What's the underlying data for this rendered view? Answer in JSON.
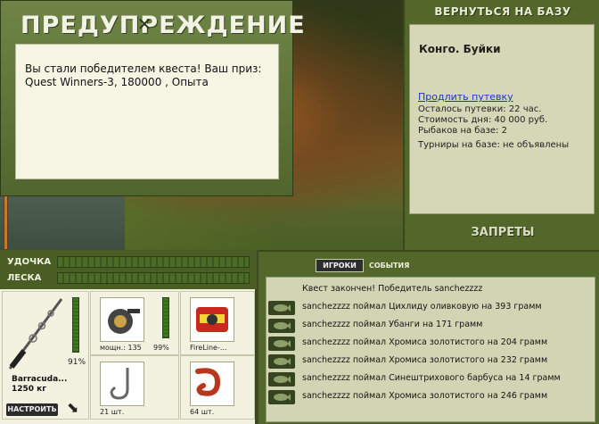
{
  "warning": {
    "title": "ПРЕДУПРЕЖДЕНИЕ",
    "message_line1": "Вы стали победителем квеста! Ваш приз:",
    "message_line2": "Quest Winners-3, 180000 , Опыта"
  },
  "base": {
    "return_label": "ВЕРНУТЬСЯ НА БАЗУ",
    "name": "Конго. Буйки",
    "extend_link": "Продлить путевку",
    "time_left": "Осталось путевки: 22 час.",
    "day_cost": "Стоимость дня: 40 000 руб.",
    "anglers": "Рыбаков на базе: 2",
    "tournaments": "Турниры на базе: не объявлены",
    "bans_label": "ЗАПРЕТЫ"
  },
  "gauges": {
    "rod_label": "УДОЧКА",
    "line_label": "ЛЕСКА"
  },
  "inventory": {
    "rod_name": "Barracuda...",
    "rod_weight": "1250 кг",
    "rod_condition": "91%",
    "setup_button": "НАСТРОИТЬ",
    "reel_power": "мощн.: 135",
    "reel_condition": "99%",
    "line_name": "FireLine-...",
    "hook_count": "21 шт.",
    "bait_count": "64 шт.",
    "icons": {
      "rod": "fishing-rod-icon",
      "reel": "reel-icon",
      "line": "line-spool-icon",
      "hook": "hook-icon",
      "bait": "worm-bait-icon",
      "arrow": "arrow-down-right-icon"
    }
  },
  "events": {
    "tab_players": "ИГРОКИ",
    "tab_events": "СОБЫТИЯ",
    "items": [
      "Квест закончен! Победитель sanchezzzz",
      "sanchezzzz поймал Цихлиду оливковую на 393 грамм",
      "sanchezzzz поймал Убанги на 171 грамм",
      "sanchezzzz поймал Хромиса золотистого на 204 грамм",
      "sanchezzzz поймал Хромиса золотистого на 232 грамм",
      "sanchezzzz поймал Синештрихового барбуса на 14 грамм",
      "sanchezzzz поймал Хромиса золотистого на 246 грамм"
    ]
  }
}
